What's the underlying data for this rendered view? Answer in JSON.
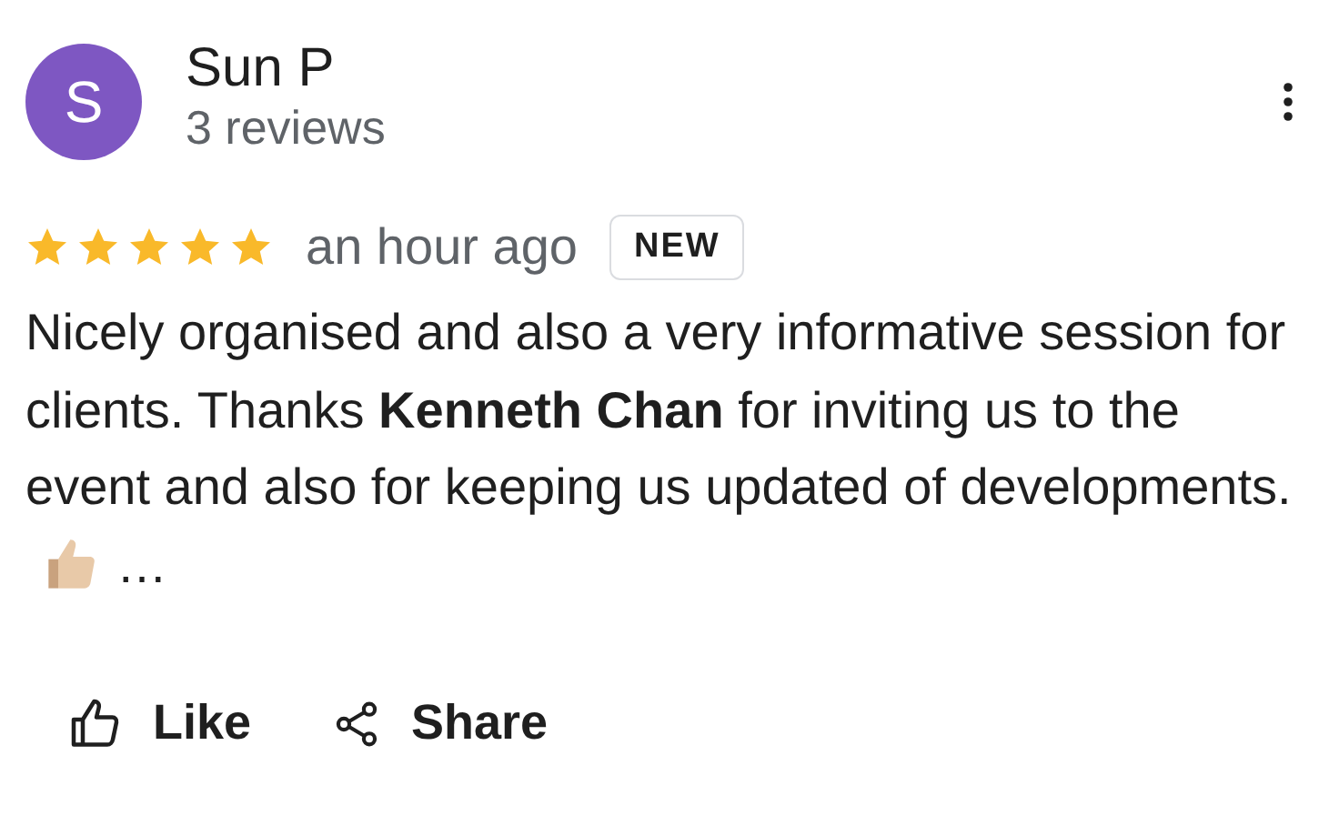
{
  "reviewer": {
    "initial": "S",
    "name": "Sun P",
    "meta": "3 reviews"
  },
  "review": {
    "stars": 5,
    "time": "an hour ago",
    "badge": "NEW",
    "text": "Nicely organised and also a very informative session for clients. Thanks **Kenneth Chan** for inviting us to the event and also for keeping us updated of developments.",
    "more": "…"
  },
  "actions": [
    {
      "kind": "like",
      "label": "Like"
    },
    {
      "kind": "share",
      "label": "Share"
    }
  ]
}
